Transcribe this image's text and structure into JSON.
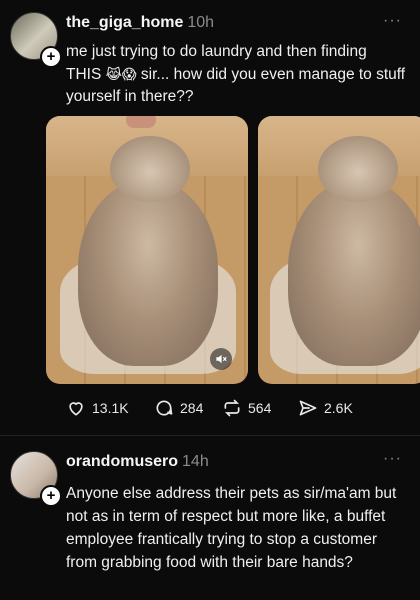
{
  "posts": [
    {
      "username": "the_giga_home",
      "time": "10h",
      "caption_a": "me just trying to do laundry and then finding THIS ",
      "caption_emojis": "😹😱",
      "caption_b": " sir... how did you even manage to stuff yourself in there??",
      "media": [
        {
          "kind": "cat-in-bag-photo",
          "muted_icon": "volume-muted-icon"
        },
        {
          "kind": "cat-in-bag-photo"
        }
      ],
      "stats": {
        "likes": "13.1K",
        "comments": "284",
        "reposts": "564",
        "shares": "2.6K"
      }
    },
    {
      "username": "orandomusero",
      "time": "14h",
      "caption": "Anyone else address their pets as sir/ma'am but not as in term of respect but more like, a buffet employee frantically trying to stop a customer from grabbing food with their bare hands?"
    }
  ],
  "ui": {
    "more_glyph": "···",
    "plus_glyph": "+"
  },
  "colors": {
    "background": "#0b0b0b",
    "text": "#f3f3f3",
    "muted": "#8a8a8a"
  }
}
